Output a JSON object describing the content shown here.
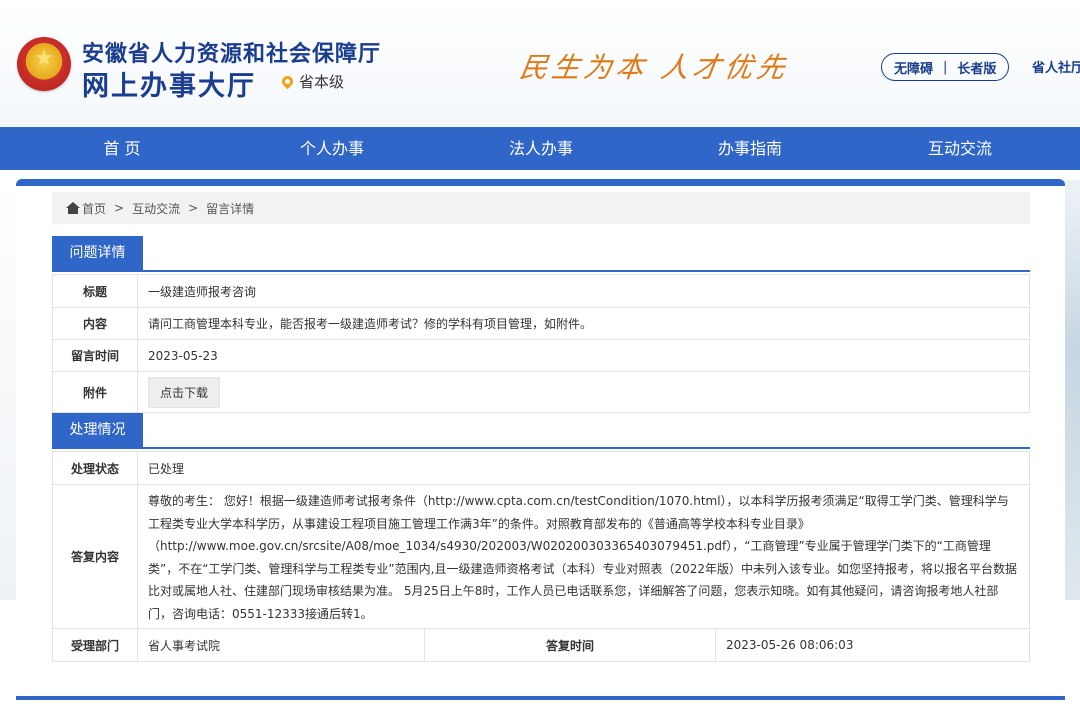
{
  "header": {
    "title": "安徽省人力资源和社会保障厅",
    "subtitle": "网上办事大厅",
    "location": "省本级",
    "slogan": "民生为本 人才优先",
    "accessibility": "无障碍",
    "elder_mode": "长者版",
    "hall_link": "省人社厅",
    "separator": "|"
  },
  "nav": {
    "items": [
      "首 页",
      "个人办事",
      "法人办事",
      "办事指南",
      "互动交流"
    ]
  },
  "breadcrumb": {
    "home": "首页",
    "sep": ">",
    "level2": "互动交流",
    "level3": "留言详情"
  },
  "question": {
    "section_title": "问题详情",
    "title_label": "标题",
    "title_value": "一级建造师报考咨询",
    "content_label": "内容",
    "content_value": "请问工商管理本科专业，能否报考一级建造师考试？修的学科有项目管理，如附件。",
    "time_label": "留言时间",
    "time_value": "2023-05-23",
    "attachment_label": "附件",
    "download_label": "点击下载"
  },
  "handling": {
    "section_title": "处理情况",
    "status_label": "处理状态",
    "status_value": "已处理",
    "reply_label": "答复内容",
    "reply_value": "尊敬的考生： 您好！根据一级建造师考试报考条件（http://www.cpta.com.cn/testCondition/1070.html），以本科学历报考须满足“取得工学门类、管理科学与工程类专业大学本科学历，从事建设工程项目施工管理工作满3年”的条件。对照教育部发布的《普通高等学校本科专业目录》（http://www.moe.gov.cn/srcsite/A08/moe_1034/s4930/202003/W020200303365403079451.pdf），“工商管理”专业属于管理学门类下的“工商管理类”，不在“工学门类、管理科学与工程类专业”范围内,且一级建造师资格考试（本科）专业对照表（2022年版）中未列入该专业。如您坚持报考，将以报名平台数据比对或属地人社、住建部门现场审核结果为准。 5月25日上午8时，工作人员已电话联系您，详细解答了问题，您表示知晓。如有其他疑问，请咨询报考地人社部门，咨询电话：0551-12333接通后转1。",
    "dept_label": "受理部门",
    "dept_value": "省人事考试院",
    "reply_time_label": "答复时间",
    "reply_time_value": "2023-05-26 08:06:03"
  },
  "colors": {
    "brand_blue": "#2f66c8",
    "title_blue": "#1a3d8f",
    "slogan_orange": "#e07a17"
  }
}
